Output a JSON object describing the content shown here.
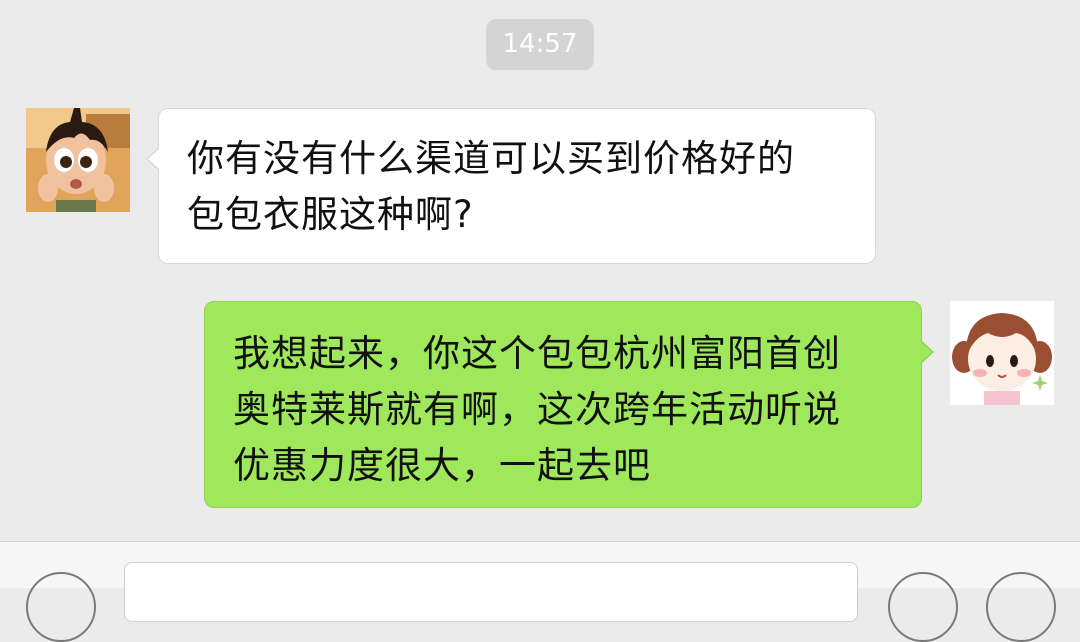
{
  "chat": {
    "timestamp": "14:57",
    "messages": [
      {
        "sender": "contact",
        "lines": [
          "你有没有什么渠道可以买到价格好的",
          "包包衣服这种啊?"
        ]
      },
      {
        "sender": "me",
        "lines": [
          "我想起来，你这个包包杭州富阳首创",
          "奥特莱斯就有啊，这次跨年活动听说",
          "优惠力度很大，一起去吧"
        ]
      }
    ]
  },
  "colors": {
    "background": "#ebebeb",
    "incoming_bubble": "#ffffff",
    "outgoing_bubble": "#9fe85b",
    "timestamp_pill": "#d4d4d4"
  },
  "icons": {
    "contact_avatar": "cartoon-girl-avatar-icon",
    "my_avatar": "cartoon-girl-pigtails-avatar-icon",
    "voice": "voice-icon",
    "emoji": "emoji-icon",
    "more": "plus-icon"
  }
}
